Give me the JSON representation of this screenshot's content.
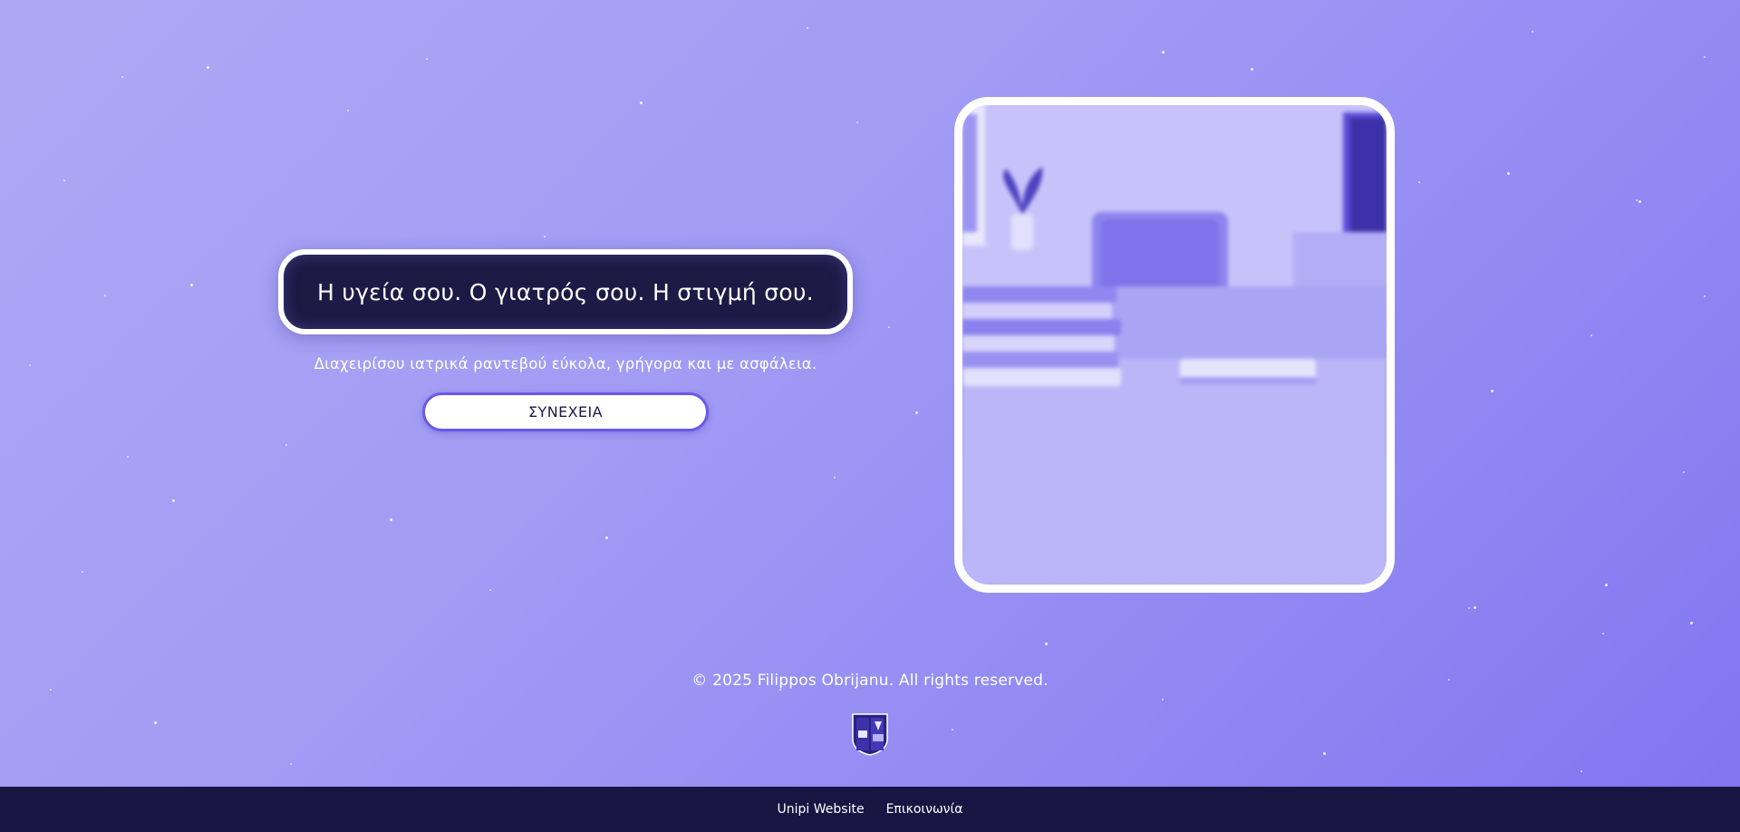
{
  "hero": {
    "headline": "Η υγεία σου. Ο γιατρός σου. Η στιγμή σου.",
    "subtitle": "Διαχειρίσου ιατρικά ραντεβού εύκολα, γρήγορα και με ασφάλεια.",
    "continue_label": "ΣΥΝΕΧΕΙΑ"
  },
  "image_card": {
    "description_icon": "office-desk-photo"
  },
  "footer": {
    "copyright": "© 2025 Filippos Obrijanu. All rights reserved.",
    "crest_icon": "university-crest-icon",
    "links": [
      {
        "label": "Unipi Website"
      },
      {
        "label": "Επικοινωνία"
      }
    ]
  },
  "colors": {
    "background_start": "#ada8f5",
    "background_end": "#8074f0",
    "headline_bg": "#1d1a45",
    "accent": "#6a58e8",
    "bottom_bar": "#181542"
  }
}
